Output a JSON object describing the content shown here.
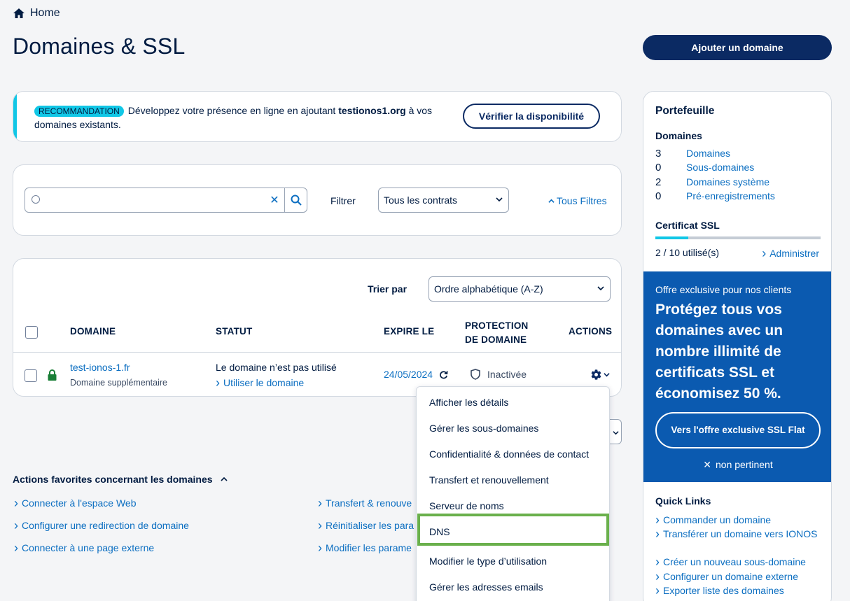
{
  "breadcrumb": {
    "home": "Home"
  },
  "page": {
    "title": "Domaines & SSL",
    "add_domain_button": "Ajouter un domaine"
  },
  "recommendation": {
    "badge": "RECOMMANDATION",
    "text_before": "Développez votre présence en ligne en ajoutant ",
    "domain": "testionos1.org",
    "text_after": " à vos domaines existants.",
    "button": "Vérifier la disponibilité"
  },
  "search": {
    "placeholder": "",
    "filter_label": "Filtrer",
    "filter_value": "Tous les contrats",
    "all_filters": "Tous Filtres"
  },
  "table": {
    "sort_label": "Trier par",
    "sort_value": "Ordre alphabétique (A-Z)",
    "headers": {
      "domain": "DOMAINE",
      "status": "STATUT",
      "expires": "EXPIRE LE",
      "protection_1": "PROTECTION",
      "protection_2": "DE DOMAINE",
      "actions": "ACTIONS"
    },
    "rows": [
      {
        "domain": "test-ionos-1.fr",
        "domain_type": "Domaine supplémentaire",
        "status": "Le domaine n’est pas utilisé",
        "status_link": "Utiliser le domaine",
        "expires": "24/05/2024",
        "protection": "Inactivée"
      }
    ]
  },
  "actions_menu": {
    "items": [
      "Afficher les détails",
      "Gérer les sous-domaines",
      "Confidentialité & données de contact",
      "Transfert et renouvellement",
      "Serveur de noms",
      "DNS",
      "Modifier le type d’utilisation",
      "Gérer les adresses emails"
    ]
  },
  "favorites": {
    "title": "Actions favorites concernant les domaines",
    "left": [
      "Connecter à l'espace Web",
      "Configurer une redirection de domaine",
      "Connecter à une page externe"
    ],
    "right": [
      "Transfert & renouve",
      "Réinitialiser les para",
      "Modifier les parame"
    ]
  },
  "sidebar": {
    "title": "Portefeuille",
    "domains_heading": "Domaines",
    "domain_counts": [
      {
        "count": "3",
        "label": "Domaines"
      },
      {
        "count": "0",
        "label": "Sous-domaines"
      },
      {
        "count": "2",
        "label": "Domaines système"
      },
      {
        "count": "0",
        "label": "Pré-enregistrements"
      }
    ],
    "ssl_heading": "Certificat SSL",
    "ssl_usage_fraction": 0.2,
    "ssl_usage_text": "2 / 10 utilisé(s)",
    "ssl_admin": "Administrer",
    "promo": {
      "small": "Offre exclusive pour nos clients",
      "big": "Protégez tous vos domaines avec un nombre illimité de certificats SSL et économisez 50 %.",
      "button": "Vers l'offre exclusive SSL Flat",
      "dismiss": "non pertinent"
    },
    "quick_links_heading": "Quick Links",
    "quick_links": [
      "Commander un domaine",
      "Transférer un domaine vers IONOS",
      "Créer un nouveau sous-domaine",
      "Configurer un domaine externe",
      "Exporter liste des domaines"
    ]
  },
  "colors": {
    "navy": "#0b2a63",
    "link": "#0b6ec1",
    "accent_cyan": "#11c7e6",
    "promo_blue": "#0b5ab0",
    "highlight_green": "#6ab04c",
    "lock_green": "#1a7f37"
  },
  "icons": [
    "home-icon",
    "search-icon",
    "clear-icon",
    "lock-icon",
    "refresh-icon",
    "shield-icon",
    "gear-icon",
    "chevron-down-icon",
    "chevron-up-icon",
    "chevron-right-icon",
    "close-icon"
  ]
}
